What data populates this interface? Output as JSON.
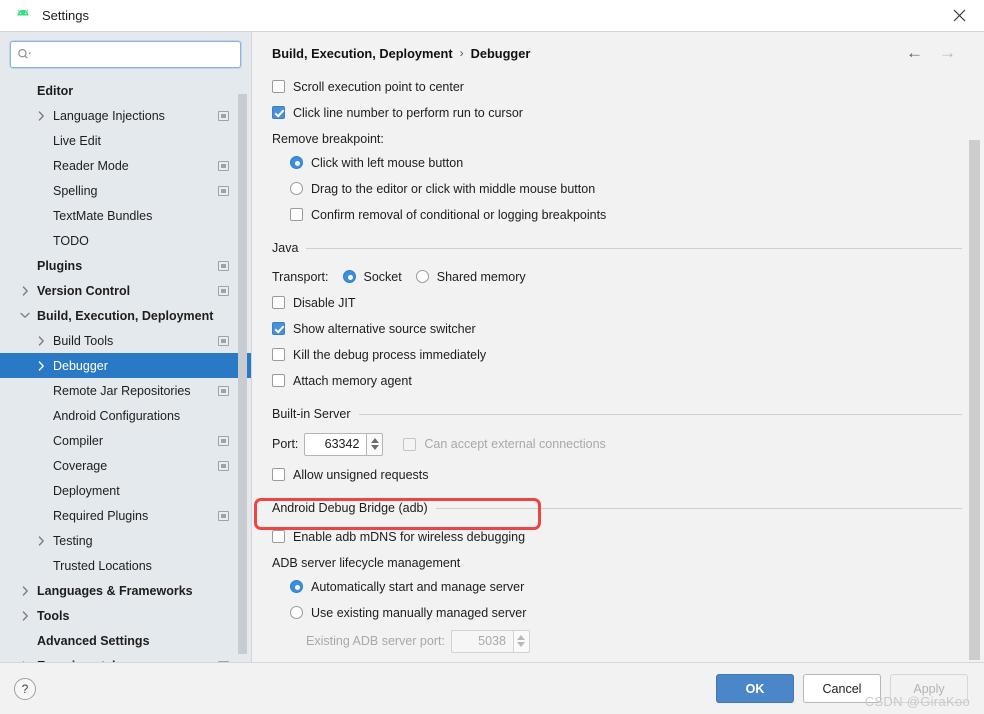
{
  "window": {
    "title": "Settings",
    "app_icon": "android-icon",
    "close_icon": "close-icon"
  },
  "sidebar": {
    "search": {
      "value": "",
      "placeholder": "",
      "icon": "search-icon"
    },
    "items": [
      {
        "label": "Editor",
        "indent": 0,
        "bold": true,
        "chevron": "none",
        "badge": false,
        "selected": false
      },
      {
        "label": "Language Injections",
        "indent": 1,
        "bold": false,
        "chevron": "right",
        "badge": true,
        "selected": false
      },
      {
        "label": "Live Edit",
        "indent": 1,
        "bold": false,
        "chevron": "none",
        "badge": false,
        "selected": false
      },
      {
        "label": "Reader Mode",
        "indent": 1,
        "bold": false,
        "chevron": "none",
        "badge": true,
        "selected": false
      },
      {
        "label": "Spelling",
        "indent": 1,
        "bold": false,
        "chevron": "none",
        "badge": true,
        "selected": false
      },
      {
        "label": "TextMate Bundles",
        "indent": 1,
        "bold": false,
        "chevron": "none",
        "badge": false,
        "selected": false
      },
      {
        "label": "TODO",
        "indent": 1,
        "bold": false,
        "chevron": "none",
        "badge": false,
        "selected": false
      },
      {
        "label": "Plugins",
        "indent": 0,
        "bold": true,
        "chevron": "none",
        "badge": true,
        "selected": false
      },
      {
        "label": "Version Control",
        "indent": 0,
        "bold": true,
        "chevron": "right",
        "badge": true,
        "selected": false
      },
      {
        "label": "Build, Execution, Deployment",
        "indent": 0,
        "bold": true,
        "chevron": "down",
        "badge": false,
        "selected": false
      },
      {
        "label": "Build Tools",
        "indent": 1,
        "bold": false,
        "chevron": "right",
        "badge": true,
        "selected": false
      },
      {
        "label": "Debugger",
        "indent": 1,
        "bold": false,
        "chevron": "right",
        "badge": false,
        "selected": true
      },
      {
        "label": "Remote Jar Repositories",
        "indent": 1,
        "bold": false,
        "chevron": "none",
        "badge": true,
        "selected": false
      },
      {
        "label": "Android Configurations",
        "indent": 1,
        "bold": false,
        "chevron": "none",
        "badge": false,
        "selected": false
      },
      {
        "label": "Compiler",
        "indent": 1,
        "bold": false,
        "chevron": "none",
        "badge": true,
        "selected": false
      },
      {
        "label": "Coverage",
        "indent": 1,
        "bold": false,
        "chevron": "none",
        "badge": true,
        "selected": false
      },
      {
        "label": "Deployment",
        "indent": 1,
        "bold": false,
        "chevron": "none",
        "badge": false,
        "selected": false
      },
      {
        "label": "Required Plugins",
        "indent": 1,
        "bold": false,
        "chevron": "none",
        "badge": true,
        "selected": false
      },
      {
        "label": "Testing",
        "indent": 1,
        "bold": false,
        "chevron": "right",
        "badge": false,
        "selected": false
      },
      {
        "label": "Trusted Locations",
        "indent": 1,
        "bold": false,
        "chevron": "none",
        "badge": false,
        "selected": false
      },
      {
        "label": "Languages & Frameworks",
        "indent": 0,
        "bold": true,
        "chevron": "right",
        "badge": false,
        "selected": false
      },
      {
        "label": "Tools",
        "indent": 0,
        "bold": true,
        "chevron": "right",
        "badge": false,
        "selected": false
      },
      {
        "label": "Advanced Settings",
        "indent": 0,
        "bold": true,
        "chevron": "none",
        "badge": false,
        "selected": false
      },
      {
        "label": "Experimental",
        "indent": 0,
        "bold": true,
        "chevron": "right",
        "badge": true,
        "selected": false
      }
    ]
  },
  "content": {
    "breadcrumb": {
      "parent": "Build, Execution, Deployment",
      "separator": "›",
      "current": "Debugger"
    },
    "nav": {
      "back_icon": "arrow-left-icon",
      "forward_icon": "arrow-right-icon"
    },
    "scroll_to_center": {
      "label": "Scroll execution point to center",
      "checked": false
    },
    "click_line_number": {
      "label": "Click line number to perform run to cursor",
      "checked": true
    },
    "remove_breakpoint": {
      "label": "Remove breakpoint:",
      "options": [
        {
          "label": "Click with left mouse button",
          "checked": true
        },
        {
          "label": "Drag to the editor or click with middle mouse button",
          "checked": false
        }
      ],
      "confirm": {
        "label": "Confirm removal of conditional or logging breakpoints",
        "checked": false
      }
    },
    "java_section": {
      "title": "Java",
      "transport_label": "Transport:",
      "transport_options": [
        {
          "label": "Socket",
          "checked": true
        },
        {
          "label": "Shared memory",
          "checked": false
        }
      ],
      "checks": [
        {
          "label": "Disable JIT",
          "checked": false
        },
        {
          "label": "Show alternative source switcher",
          "checked": true
        },
        {
          "label": "Kill the debug process immediately",
          "checked": false
        },
        {
          "label": "Attach memory agent",
          "checked": false
        }
      ]
    },
    "builtin_server": {
      "title": "Built-in Server",
      "port_label": "Port:",
      "port_value": "63342",
      "external": {
        "label": "Can accept external connections",
        "checked": false,
        "disabled": true
      },
      "allow_unsigned": {
        "label": "Allow unsigned requests",
        "checked": false
      }
    },
    "adb_section": {
      "title": "Android Debug Bridge (adb)",
      "mdns": {
        "label": "Enable adb mDNS for wireless debugging",
        "checked": false
      },
      "lifecycle_label": "ADB server lifecycle management",
      "lifecycle_options": [
        {
          "label": "Automatically start and manage server",
          "checked": true
        },
        {
          "label": "Use existing manually managed server",
          "checked": false
        }
      ],
      "existing_port_label": "Existing ADB server port:",
      "existing_port_value": "5038"
    },
    "highlight_color": "#ef4444"
  },
  "footer": {
    "help_label": "?",
    "ok_label": "OK",
    "cancel_label": "Cancel",
    "apply_label": "Apply",
    "watermark": "CSDN @GiraKoo"
  }
}
